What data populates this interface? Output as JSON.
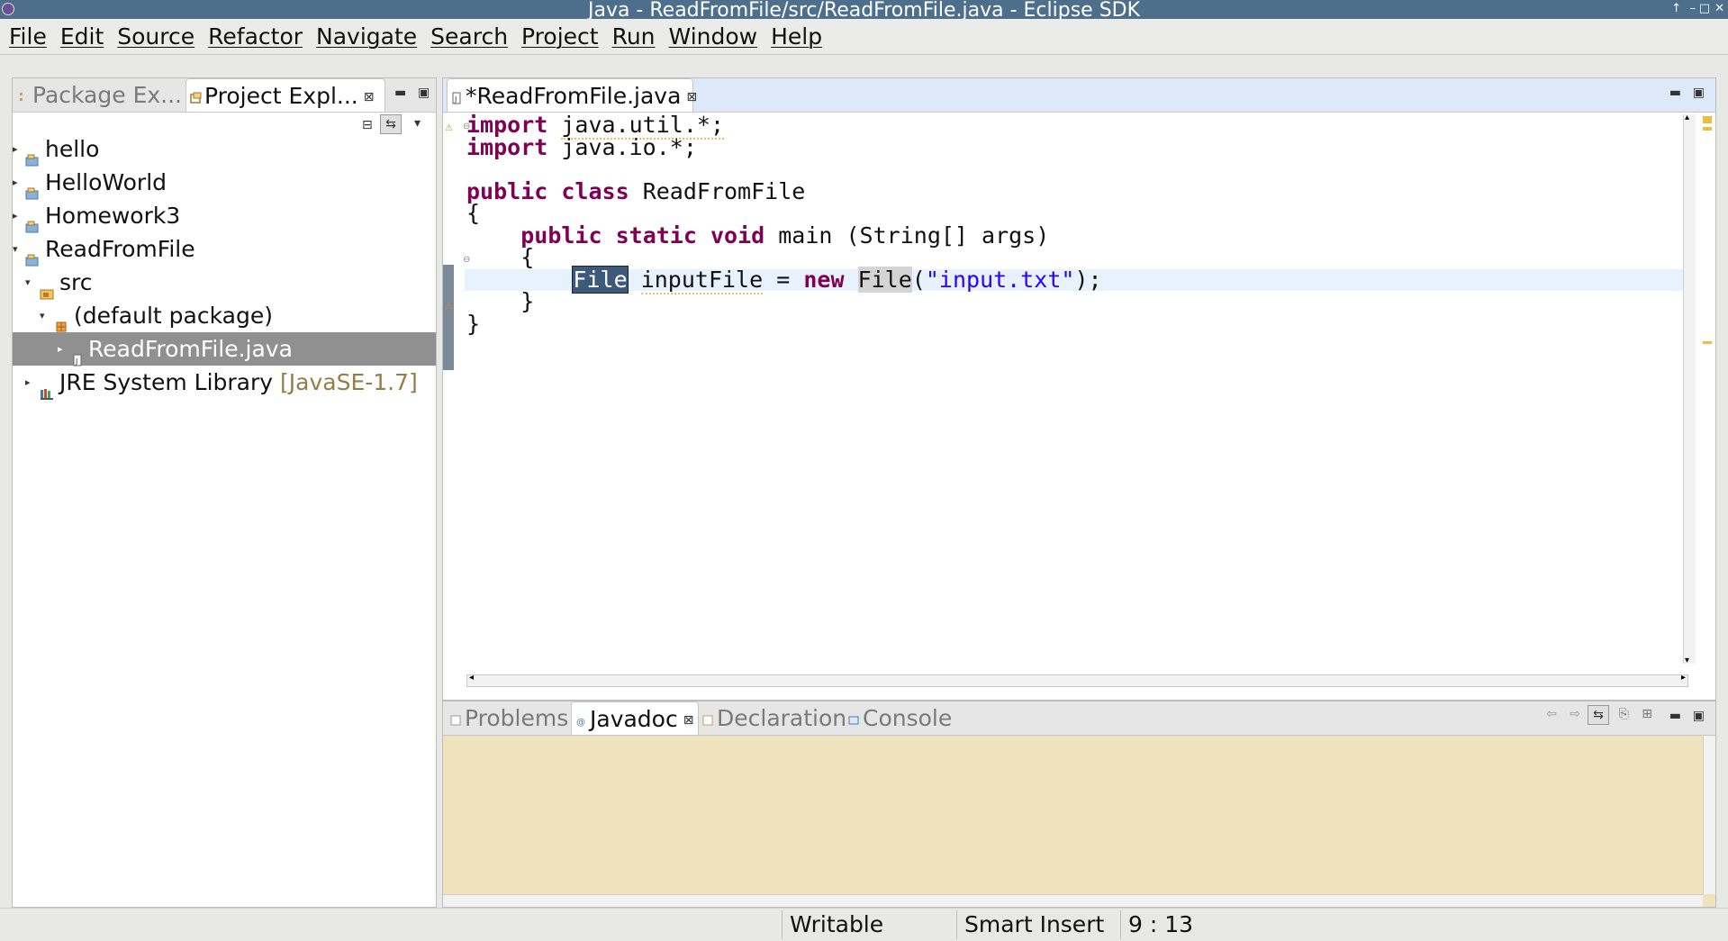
{
  "window": {
    "title": "Java - ReadFromFile/src/ReadFromFile.java - Eclipse SDK",
    "controls": [
      "↑",
      "–",
      "□",
      "✕"
    ]
  },
  "menu": [
    "File",
    "Edit",
    "Source",
    "Refactor",
    "Navigate",
    "Search",
    "Project",
    "Run",
    "Window",
    "Help"
  ],
  "explorer": {
    "tabs": [
      {
        "label": "Package Ex..."
      },
      {
        "label": "Project Expl..."
      }
    ],
    "tree": [
      {
        "label": "hello",
        "level": 0,
        "expanded": false,
        "icon": "project-icon"
      },
      {
        "label": "HelloWorld",
        "level": 0,
        "expanded": false,
        "icon": "project-icon"
      },
      {
        "label": "Homework3",
        "level": 0,
        "expanded": false,
        "icon": "project-icon"
      },
      {
        "label": "ReadFromFile",
        "level": 0,
        "expanded": true,
        "icon": "project-icon"
      },
      {
        "label": "src",
        "level": 1,
        "expanded": true,
        "icon": "source-folder-icon"
      },
      {
        "label": "(default package)",
        "level": 2,
        "expanded": true,
        "icon": "package-icon"
      },
      {
        "label": "ReadFromFile.java",
        "level": 3,
        "expanded": false,
        "icon": "java-file-icon",
        "selected": true
      },
      {
        "label": "JRE System Library",
        "decoration": "[JavaSE-1.7]",
        "level": 1,
        "expanded": false,
        "icon": "library-icon"
      }
    ]
  },
  "editor": {
    "tab": "*ReadFromFile.java",
    "code": {
      "l1_kw": "import",
      "l1_rest": "java.util.*;",
      "l2_kw": "import",
      "l2_rest": "java.io.*;",
      "l4_kw1": "public",
      "l4_kw2": "class",
      "l4_rest": "ReadFromFile",
      "l5": "{",
      "l6_kw1": "public",
      "l6_kw2": "static",
      "l6_kw3": "void",
      "l6_rest": "main (String[] args)",
      "l7": "{",
      "l8_type": "File",
      "l8_var": "inputFile",
      "l8_eq": "=",
      "l8_kw": "new",
      "l8_type2": "File",
      "l8_open": "(",
      "l8_str": "\"input.txt\"",
      "l8_close": ");",
      "l9": "}",
      "l10": "}"
    }
  },
  "bottom": {
    "tabs": [
      {
        "label": "Problems"
      },
      {
        "label": "Javadoc"
      },
      {
        "label": "Declaration"
      },
      {
        "label": "Console"
      }
    ]
  },
  "status": {
    "writable": "Writable",
    "insert_mode": "Smart Insert",
    "position": "9 : 13"
  },
  "colors": {
    "keyword": "#7f0055",
    "string": "#2a00ff",
    "javadoc_bg": "#efe3bd",
    "title_bg": "#4d6f8c"
  }
}
